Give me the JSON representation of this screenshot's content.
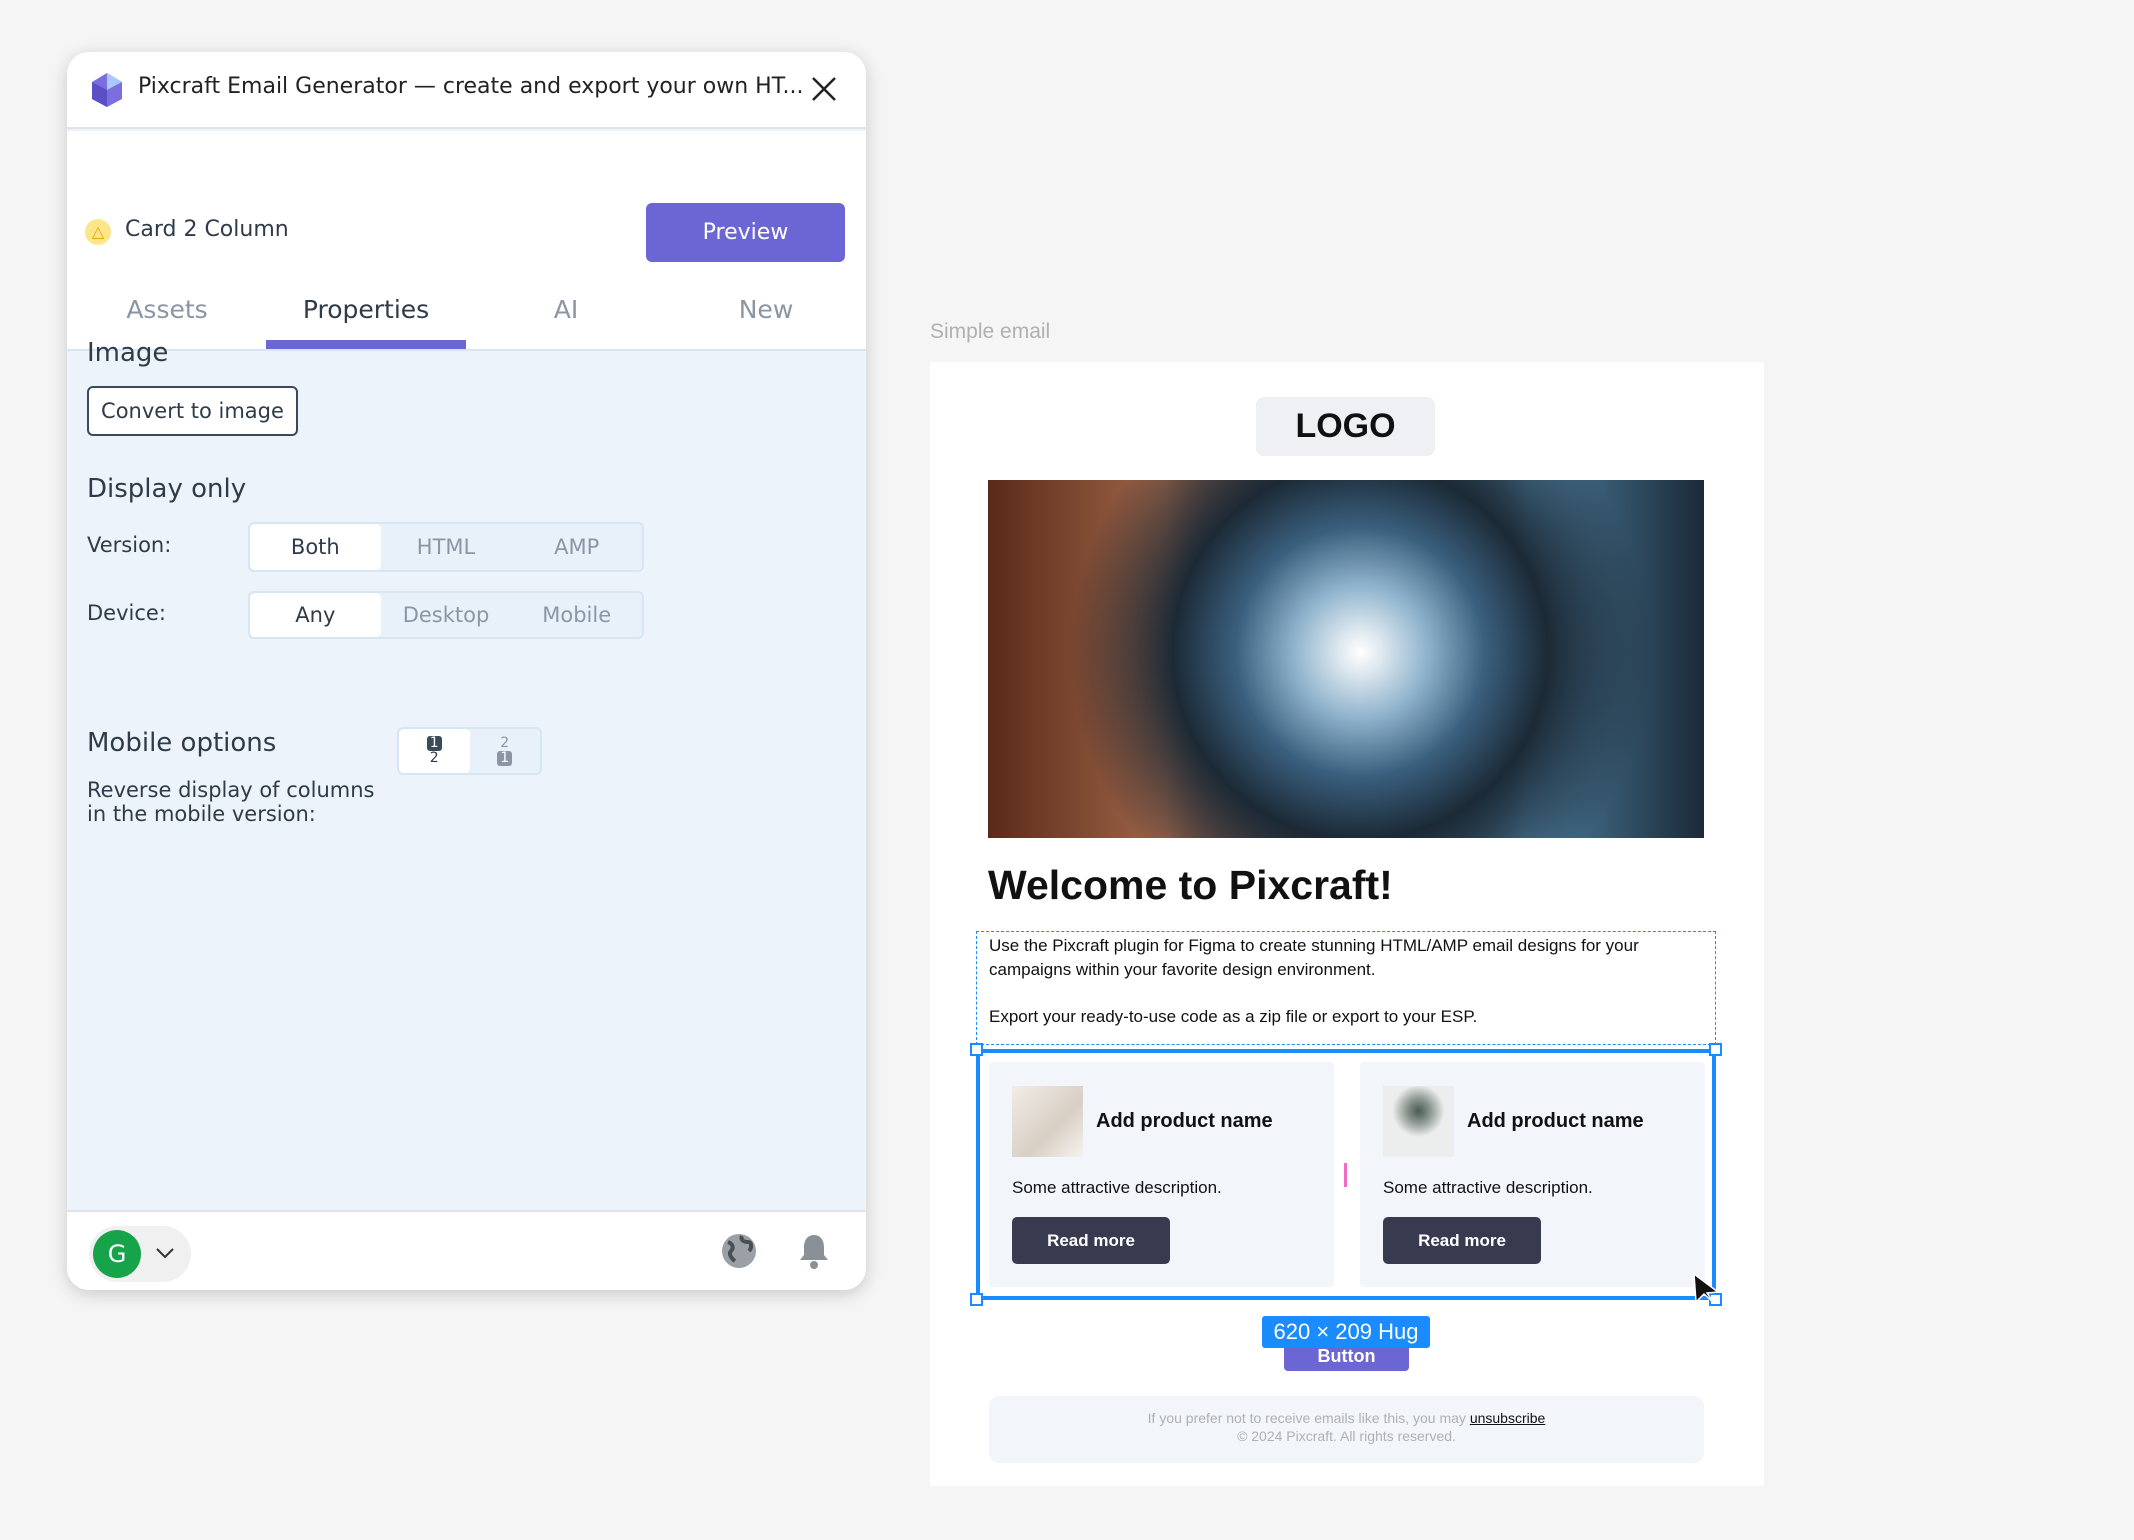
{
  "plugin": {
    "title": "Pixcraft Email Generator — create and export your own HT...",
    "component_name": "Card 2 Column",
    "preview_label": "Preview",
    "tabs": [
      {
        "label": "Assets"
      },
      {
        "label": "Properties",
        "active": true
      },
      {
        "label": "AI"
      },
      {
        "label": "New"
      }
    ],
    "image_section": {
      "heading": "Image",
      "convert_label": "Convert to image"
    },
    "display_only": {
      "heading": "Display only",
      "version_label": "Version:",
      "version_options": [
        "Both",
        "HTML",
        "AMP"
      ],
      "version_selected": "Both",
      "device_label": "Device:",
      "device_options": [
        "Any",
        "Desktop",
        "Mobile"
      ],
      "device_selected": "Any"
    },
    "mobile_options": {
      "heading": "Mobile options",
      "reverse_label_line1": "Reverse display of columns",
      "reverse_label_line2": "in the mobile version:",
      "option_normal": {
        "top": "1",
        "bottom": "2"
      },
      "option_reversed": {
        "top": "2",
        "bottom": "1"
      }
    },
    "footer": {
      "avatar_letter": "G"
    },
    "accent": "#6c66d4"
  },
  "canvas": {
    "frame_label": "Simple email",
    "logo": "LOGO",
    "heading": "Welcome to Pixcraft!",
    "body_line1": "Use the Pixcraft plugin for Figma to create stunning HTML/AMP email designs for your",
    "body_line2": "campaigns within your favorite design environment.",
    "body_line3": "Export your ready-to-use code as a zip file or export to your ESP.",
    "cards": [
      {
        "name": "Add product name",
        "description": "Some attractive description.",
        "button": "Read more"
      },
      {
        "name": "Add product name",
        "description": "Some attractive description.",
        "button": "Read more"
      }
    ],
    "hidden_button": "Button",
    "size_badge": "620 × 209 Hug",
    "footer_text": "If you prefer not to receive emails like this, you may ",
    "unsubscribe": "unsubscribe",
    "copyright": "© 2024 Pixcraft. All rights reserved.",
    "selection_color": "#1a8cff"
  }
}
